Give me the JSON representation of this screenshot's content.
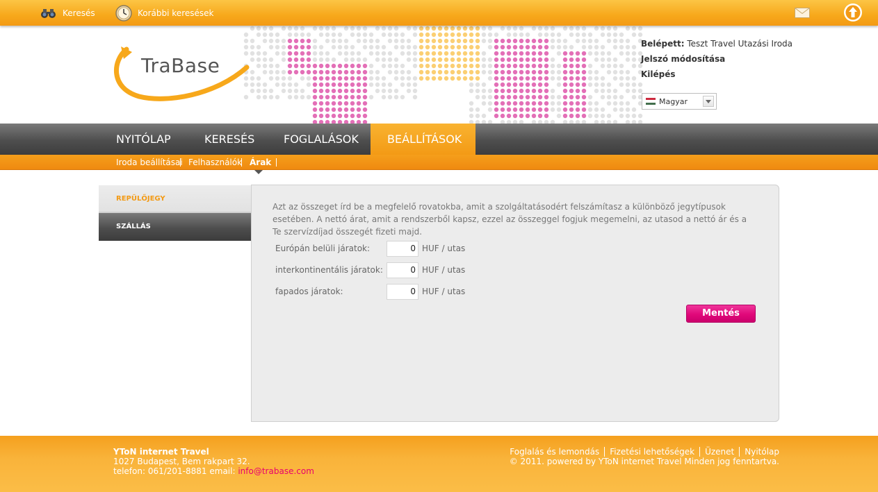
{
  "topbar": {
    "search_label": "Keresés",
    "history_label": "Korábbi keresések"
  },
  "header": {
    "logo_text": "TraBase",
    "logged_in_label": "Belépett:",
    "logged_in_value": "Teszt Travel Utazási Iroda",
    "change_password": "Jelszó módosítása",
    "logout": "Kilépés",
    "language": "Magyar"
  },
  "nav": {
    "items": [
      {
        "label": "NYITÓLAP"
      },
      {
        "label": "KERESÉS"
      },
      {
        "label": "FOGLALÁSOK"
      },
      {
        "label": "BEÁLLÍTÁSOK"
      }
    ],
    "active_index": 3
  },
  "subnav": {
    "items": [
      {
        "label": "Iroda beállításai"
      },
      {
        "label": "Felhasználók"
      },
      {
        "label": "Árak"
      }
    ]
  },
  "sidebar": {
    "tabs": [
      {
        "label": "REPÜLŐJEGY"
      },
      {
        "label": "SZÁLLÁS"
      }
    ]
  },
  "form": {
    "description": "Azt az összeget írd be a megfelelő rovatokba, amit a szolgáltatásodért felszámítasz a különböző jegytípusok esetében. A nettó árat, amit a rendszerből kapsz, ezzel az összeggel fogjuk megemelni, az utasod a nettó ár és a Te szervízdíjad összegét fizeti majd.",
    "fields": [
      {
        "label": "Európán belüli járatok:",
        "value": "0",
        "unit": "HUF / utas"
      },
      {
        "label": "interkontinentális járatok:",
        "value": "0",
        "unit": "HUF / utas"
      },
      {
        "label": "fapados járatok:",
        "value": "0",
        "unit": "HUF / utas"
      }
    ],
    "save_label": "Mentés"
  },
  "footer": {
    "company": "YToN internet Travel",
    "address": "1027 Budapest, Bem rakpart 32.",
    "phone_prefix": "telefon: 061/201-8881 email:",
    "email": "info@trabase.com",
    "links": [
      {
        "label": "Foglalás és lemondás"
      },
      {
        "label": "Fizetési lehetőségek"
      },
      {
        "label": "Üzenet"
      },
      {
        "label": "Nyitólap"
      }
    ],
    "copyright": "© 2011. powered by YToN internet Travel Minden jog fenntartva."
  },
  "colors": {
    "brand_orange": "#f7a81b",
    "accent_pink": "#e0087a",
    "nav_dark": "#4e4e4e"
  },
  "icons": [
    "binoculars-icon",
    "clock-icon",
    "mail-icon",
    "arrow-up-icon",
    "chevron-down-icon",
    "hungarian-flag-icon"
  ]
}
